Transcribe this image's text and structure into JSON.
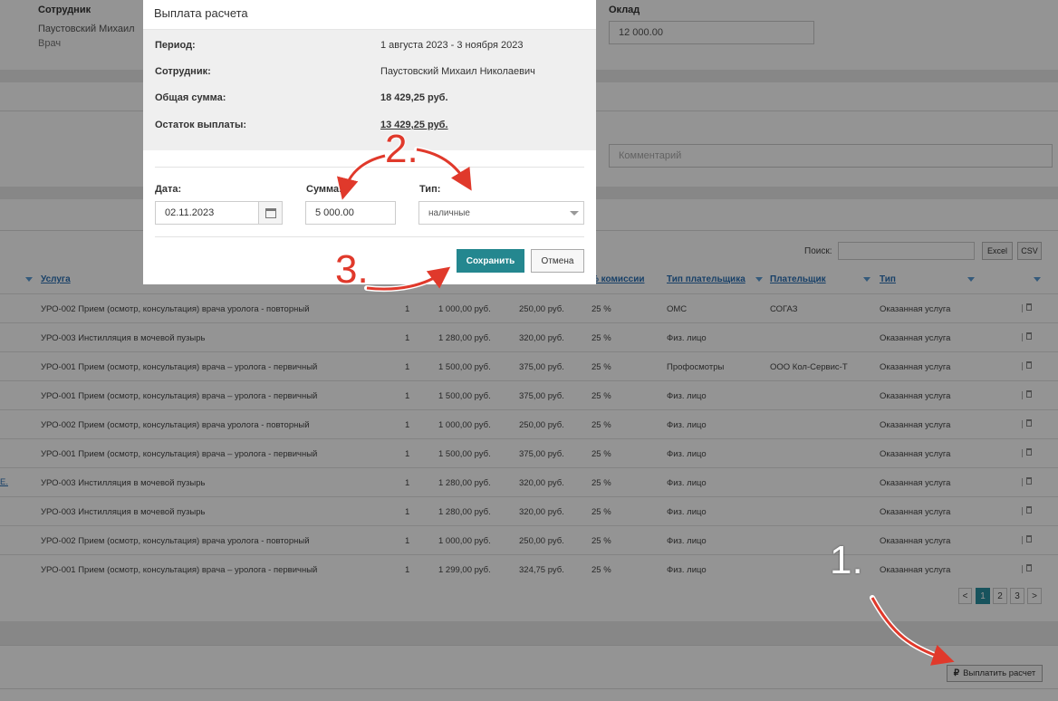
{
  "background": {
    "employee": {
      "label": "Сотрудник",
      "name": "Паустовский Михаил",
      "role": "Врач"
    },
    "salary": {
      "label": "Оклад",
      "value": "12 000.00"
    },
    "comment": {
      "placeholder": "Комментарий"
    },
    "table_tools": {
      "search_label": "Поиск:",
      "excel_label": "Excel",
      "csv_label": "CSV"
    },
    "table": {
      "headers": {
        "service": "Услуга",
        "commission": "% комиссии",
        "payer_type": "Тип плательщика",
        "payer": "Плательщик",
        "type": "Тип"
      },
      "rows": [
        {
          "service": "УРО-002 Прием (осмотр, консультация) врача уролога - повторный",
          "qty": "1",
          "price": "1 000,00 руб.",
          "fee": "250,00 руб.",
          "pct": "25 %",
          "payer_type": "ОМС",
          "payer": "СОГАЗ",
          "type": "Оказанная услуга"
        },
        {
          "service": "УРО-003 Инстилляция в мочевой пузырь",
          "qty": "1",
          "price": "1 280,00 руб.",
          "fee": "320,00 руб.",
          "pct": "25 %",
          "payer_type": "Физ. лицо",
          "payer": "",
          "type": "Оказанная услуга"
        },
        {
          "service": "УРО-001 Прием (осмотр, консультация) врача – уролога - первичный",
          "qty": "1",
          "price": "1 500,00 руб.",
          "fee": "375,00 руб.",
          "pct": "25 %",
          "payer_type": "Профосмотры",
          "payer": "ООО Кол-Сервис-Т",
          "type": "Оказанная услуга"
        },
        {
          "service": "УРО-001 Прием (осмотр, консультация) врача – уролога - первичный",
          "qty": "1",
          "price": "1 500,00 руб.",
          "fee": "375,00 руб.",
          "pct": "25 %",
          "payer_type": "Физ. лицо",
          "payer": "",
          "type": "Оказанная услуга"
        },
        {
          "service": "УРО-002 Прием (осмотр, консультация) врача уролога - повторный",
          "qty": "1",
          "price": "1 000,00 руб.",
          "fee": "250,00 руб.",
          "pct": "25 %",
          "payer_type": "Физ. лицо",
          "payer": "",
          "type": "Оказанная услуга"
        },
        {
          "service": "УРО-001 Прием (осмотр, консультация) врача – уролога - первичный",
          "qty": "1",
          "price": "1 500,00 руб.",
          "fee": "375,00 руб.",
          "pct": "25 %",
          "payer_type": "Физ. лицо",
          "payer": "",
          "type": "Оказанная услуга"
        },
        {
          "service": "УРО-003 Инстилляция в мочевой пузырь",
          "qty": "1",
          "price": "1 280,00 руб.",
          "fee": "320,00 руб.",
          "pct": "25 %",
          "payer_type": "Физ. лицо",
          "payer": "",
          "type": "Оказанная услуга"
        },
        {
          "service": "УРО-003 Инстилляция в мочевой пузырь",
          "qty": "1",
          "price": "1 280,00 руб.",
          "fee": "320,00 руб.",
          "pct": "25 %",
          "payer_type": "Физ. лицо",
          "payer": "",
          "type": "Оказанная услуга"
        },
        {
          "service": "УРО-002 Прием (осмотр, консультация) врача уролога - повторный",
          "qty": "1",
          "price": "1 000,00 руб.",
          "fee": "250,00 руб.",
          "pct": "25 %",
          "payer_type": "Физ. лицо",
          "payer": "",
          "type": "Оказанная услуга"
        },
        {
          "service": "УРО-001 Прием (осмотр, консультация) врача – уролога - первичный",
          "qty": "1",
          "price": "1 299,00 руб.",
          "fee": "324,75 руб.",
          "pct": "25 %",
          "payer_type": "Физ. лицо",
          "payer": "",
          "type": "Оказанная услуга"
        }
      ],
      "left_link": "E."
    },
    "pagination": {
      "prev": "<",
      "pages": [
        "1",
        "2",
        "3"
      ],
      "next": ">",
      "current": "1"
    },
    "pay_button": {
      "icon": "ruble-icon",
      "label": "Выплатить расчет"
    }
  },
  "modal": {
    "title": "Выплата расчета",
    "info": {
      "period_label": "Период:",
      "period_value": "1 августа 2023 - 3 ноября 2023",
      "employee_label": "Сотрудник:",
      "employee_value": "Паустовский Михаил Николаевич",
      "total_label": "Общая сумма:",
      "total_value": "18 429,25 руб.",
      "remaining_label": "Остаток выплаты:",
      "remaining_value": "13 429,25 руб."
    },
    "form": {
      "date_label": "Дата:",
      "date_value": "02.11.2023",
      "amount_label": "Сумма:",
      "amount_value": "5 000.00",
      "type_label": "Тип:",
      "type_value": "наличные"
    },
    "save_label": "Сохранить",
    "cancel_label": "Отмена"
  },
  "annotations": {
    "step1": "1.",
    "step2": "2.",
    "step3": "3.",
    "arrow_color": "#e0392b"
  }
}
